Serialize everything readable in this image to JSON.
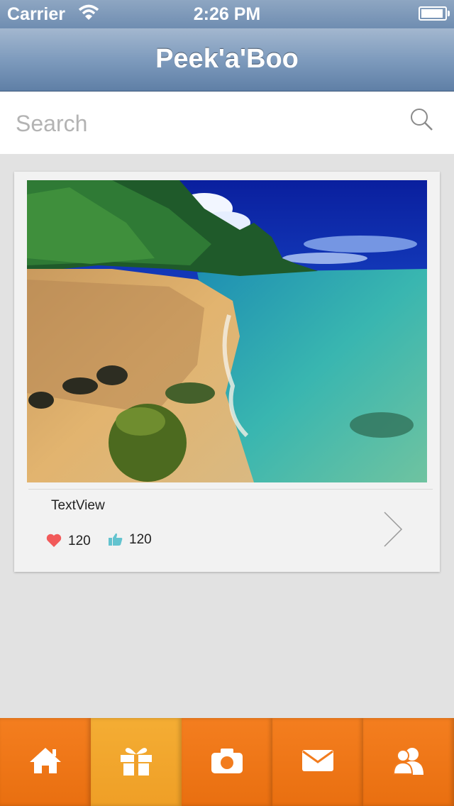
{
  "status_bar": {
    "carrier": "Carrier",
    "time": "2:26 PM"
  },
  "nav": {
    "title": "Peek'a'Boo"
  },
  "search": {
    "placeholder": "Search"
  },
  "card": {
    "caption": "TextView",
    "likes": "120",
    "thumbs": "120"
  },
  "tabs": [
    {
      "icon": "home-icon",
      "active": false
    },
    {
      "icon": "gift-icon",
      "active": true
    },
    {
      "icon": "camera-icon",
      "active": false
    },
    {
      "icon": "mail-icon",
      "active": false
    },
    {
      "icon": "contacts-icon",
      "active": false
    }
  ],
  "colors": {
    "tab_orange": "#f47e1f",
    "tab_active": "#f4ad34",
    "heart": "#f25a5a",
    "thumb": "#63c3cf"
  }
}
